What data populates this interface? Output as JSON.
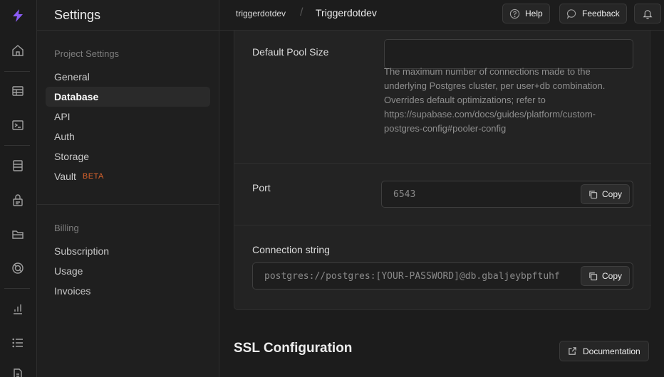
{
  "rail": {
    "items": [
      "logo-icon",
      "home-icon",
      "table-editor-icon",
      "sql-editor-icon",
      "database-icon",
      "auth-icon",
      "storage-icon",
      "realtime-icon",
      "reports-icon",
      "logs-icon",
      "docs-icon"
    ]
  },
  "menu": {
    "title": "Settings",
    "groups": [
      {
        "title": "Project Settings",
        "items": [
          {
            "label": "General"
          },
          {
            "label": "Database",
            "active": true
          },
          {
            "label": "API"
          },
          {
            "label": "Auth"
          },
          {
            "label": "Storage"
          },
          {
            "label": "Vault",
            "badge": "BETA"
          }
        ]
      },
      {
        "title": "Billing",
        "items": [
          {
            "label": "Subscription"
          },
          {
            "label": "Usage"
          },
          {
            "label": "Invoices"
          }
        ]
      }
    ]
  },
  "topbar": {
    "org": "triggerdotdev",
    "separator": "/",
    "project": "Triggerdotdev",
    "help_label": "Help",
    "feedback_label": "Feedback"
  },
  "pool": {
    "pool_size_label": "Default Pool Size",
    "pool_size_value": "",
    "pool_size_help": "The maximum number of connections made to the underlying Postgres cluster, per user+db combination. Overrides default optimizations; refer to https://supabase.com/docs/guides/platform/custom-postgres-config#pooler-config",
    "port_label": "Port",
    "port_value": "6543",
    "connection_label": "Connection string",
    "connection_value": "postgres://postgres:[YOUR-PASSWORD]@db.gbaljeybpftuhf",
    "copy_label": "Copy"
  },
  "ssl": {
    "title": "SSL Configuration",
    "doc_label": "Documentation"
  },
  "colors": {
    "accent": "#8b5cf6",
    "beta": "#d9632c",
    "background": "#1c1c1c"
  }
}
